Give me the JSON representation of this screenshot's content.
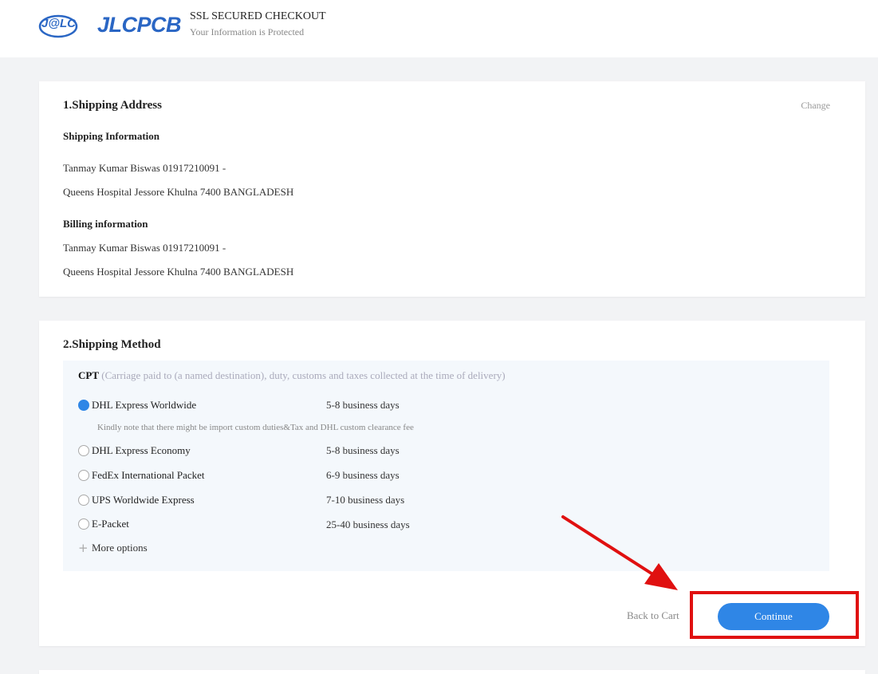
{
  "header": {
    "logo_mark": "J@LC",
    "logo_text": "JLCPCB",
    "secure_title": "SSL SECURED CHECKOUT",
    "secure_subtitle": "Your Information is Protected",
    "brand_color": "#2a66c4"
  },
  "shipping_address": {
    "title": "1.Shipping Address",
    "change_label": "Change",
    "shipping_info_label": "Shipping Information",
    "shipping_line1": "Tanmay Kumar Biswas 01917210091 -",
    "shipping_line2": "Queens Hospital Jessore Khulna 7400 BANGLADESH",
    "billing_info_label": "Billing information",
    "billing_line1": "Tanmay Kumar Biswas 01917210091 -",
    "billing_line2": "Queens Hospital Jessore Khulna 7400 BANGLADESH"
  },
  "shipping_method": {
    "title": "2.Shipping Method",
    "term_code": "CPT",
    "term_desc": "(Carriage paid to (a named destination), duty, customs and taxes collected at the time of delivery)",
    "options": [
      {
        "name": "DHL Express Worldwide",
        "days": "5-8 business days",
        "selected": true
      },
      {
        "name": "DHL Express Economy",
        "days": "5-8 business days",
        "selected": false
      },
      {
        "name": "FedEx International Packet",
        "days": "6-9 business days",
        "selected": false
      },
      {
        "name": "UPS Worldwide Express",
        "days": "7-10 business days",
        "selected": false
      },
      {
        "name": "E-Packet",
        "days": "25-40 business days",
        "selected": false
      }
    ],
    "note": "Kindly note that there might be import custom duties&Tax and DHL custom clearance fee",
    "more_options": "More options",
    "back_label": "Back to Cart",
    "continue_label": "Continue",
    "accent_color": "#2f86e6"
  },
  "annotation": {
    "highlight_color": "#e01010"
  }
}
